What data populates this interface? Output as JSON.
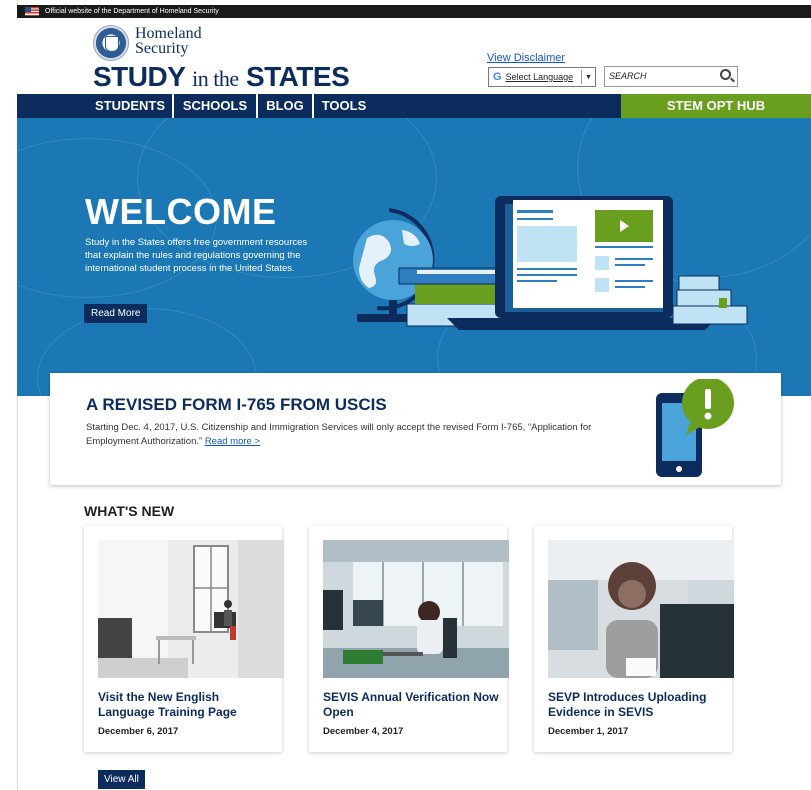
{
  "gov_banner": {
    "text": "Official website of the Department of Homeland Security"
  },
  "header": {
    "agency_line1": "Homeland",
    "agency_line2": "Security",
    "logo_study": "STUDY",
    "logo_mid": "in the",
    "logo_states": "STATES",
    "disclaimer_link": "View Disclaimer",
    "language_label": "Select Language",
    "search_placeholder": "SEARCH"
  },
  "nav": {
    "items": [
      "STUDENTS",
      "SCHOOLS",
      "BLOG",
      "TOOLS"
    ],
    "stem": "STEM OPT HUB"
  },
  "hero": {
    "title": "WELCOME",
    "text": "Study in the States offers free government resources that explain the rules and regulations governing the international student process in the United States.",
    "button": "Read More"
  },
  "announcement": {
    "title": "A REVISED FORM I-765 FROM USCIS",
    "text": "Starting Dec. 4, 2017, U.S. Citizenship and Immigration Services will only accept the revised Form I-765, “Application for Employment Authorization.”",
    "link": "Read more >"
  },
  "whats_new": {
    "heading": "WHAT'S NEW",
    "cards": [
      {
        "title": "Visit the New English Language Training Page",
        "date": "December 6, 2017"
      },
      {
        "title": "SEVIS Annual Verification Now Open",
        "date": "December 4, 2017"
      },
      {
        "title": "SEVP Introduces Uploading Evidence in SEVIS",
        "date": "December 1, 2017"
      }
    ],
    "view_all": "View All"
  },
  "colors": {
    "navy": "#0b2c5c",
    "hero_blue": "#1b78b5",
    "stem_green": "#6a9e1f",
    "link_blue": "#1155cc"
  }
}
